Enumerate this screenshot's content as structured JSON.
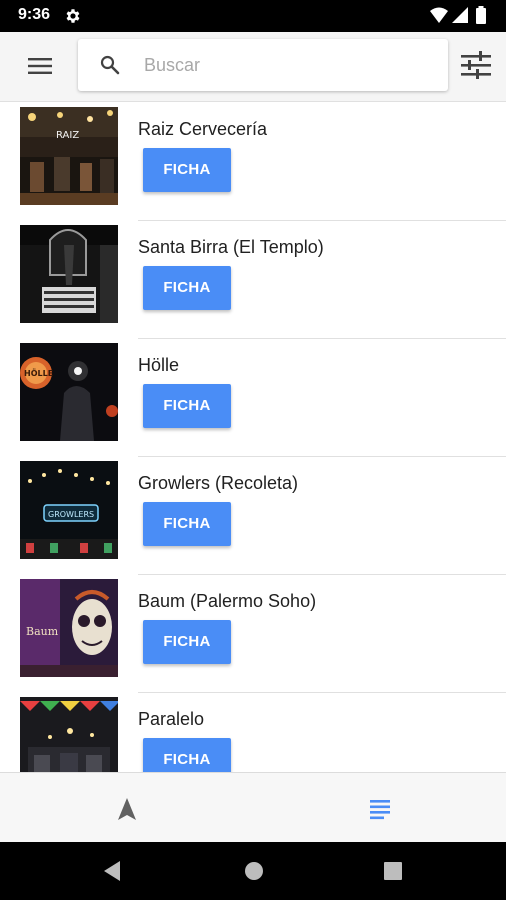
{
  "status_bar": {
    "time": "9:36"
  },
  "search": {
    "placeholder": "Buscar",
    "value": ""
  },
  "items": [
    {
      "name": "Raiz Cervecería",
      "button": "FICHA",
      "image": "bar-interior-raiz"
    },
    {
      "name": "Santa Birra (El Templo)",
      "button": "FICHA",
      "image": "storefront-santa-birra"
    },
    {
      "name": "Hölle",
      "button": "FICHA",
      "image": "night-sign-holle"
    },
    {
      "name": "Growlers (Recoleta)",
      "button": "FICHA",
      "image": "neon-sign-growlers"
    },
    {
      "name": "Baum (Palermo Soho)",
      "button": "FICHA",
      "image": "mural-baum"
    },
    {
      "name": "Paralelo",
      "button": "FICHA",
      "image": "bunting-paralelo"
    }
  ],
  "thumb_texts": {
    "raiz_sign": "RAIZ",
    "holle_sign": "HÖLLE",
    "growlers_sign": "GROWLERS",
    "baum_sign": "Baum"
  },
  "colors": {
    "accent": "#4a8df6",
    "status_bar": "#000000",
    "top_bar": "#f5f5f5",
    "nav_active": "#4a8df6",
    "nav_inactive": "#616161"
  }
}
